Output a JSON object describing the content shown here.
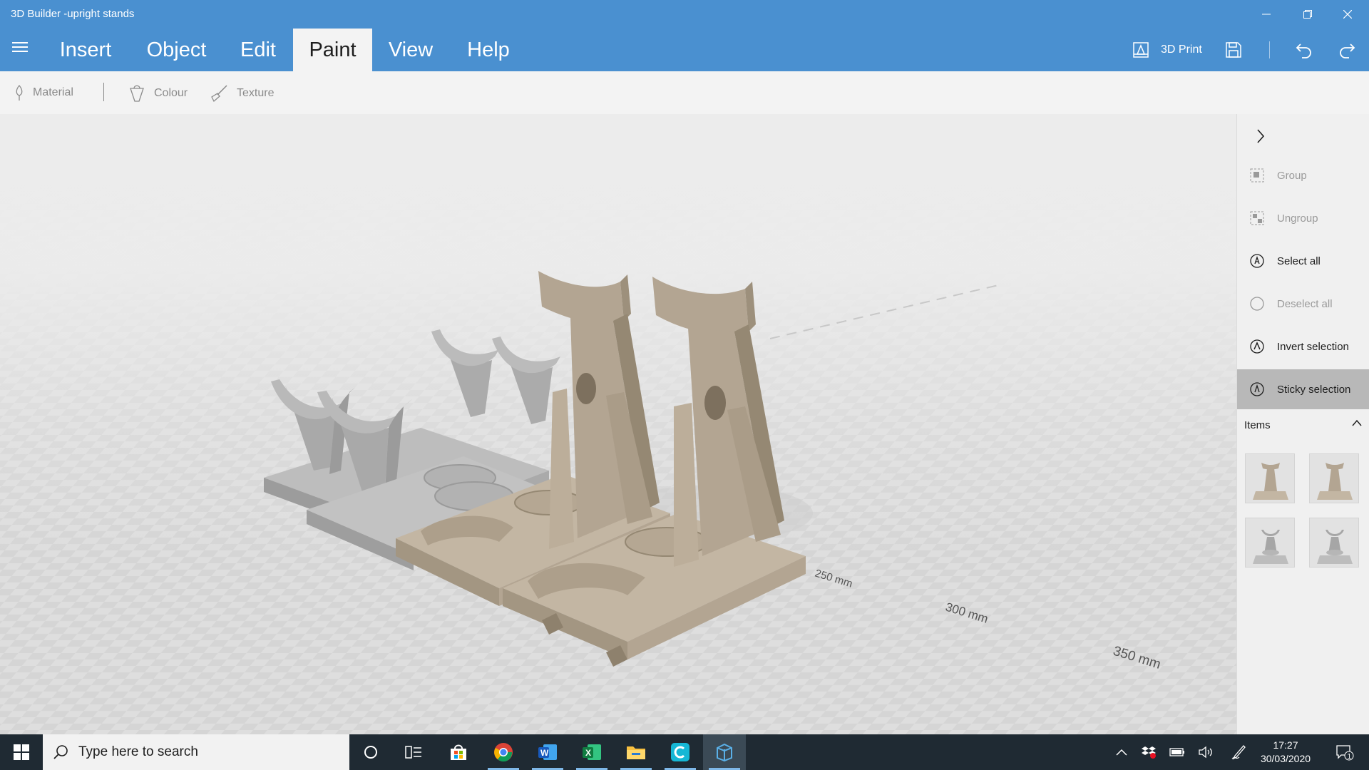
{
  "window": {
    "title": "3D Builder -upright stands",
    "controls": [
      "minimize-icon",
      "restore-icon",
      "close-icon"
    ]
  },
  "menu": {
    "tabs": [
      {
        "label": "Insert"
      },
      {
        "label": "Object"
      },
      {
        "label": "Edit"
      },
      {
        "label": "Paint",
        "active": true
      },
      {
        "label": "View"
      },
      {
        "label": "Help"
      }
    ],
    "print_label": "3D Print"
  },
  "ribbon": {
    "items": [
      {
        "label": "Material",
        "icon": "material-icon"
      },
      {
        "label": "Colour",
        "icon": "colour-bucket-icon"
      },
      {
        "label": "Texture",
        "icon": "texture-brush-icon"
      }
    ]
  },
  "viewport": {
    "scale_labels": [
      "250 mm",
      "300 mm",
      "350 mm"
    ]
  },
  "panel": {
    "actions": [
      {
        "label": "Group",
        "enabled": false,
        "icon": "group-icon"
      },
      {
        "label": "Ungroup",
        "enabled": false,
        "icon": "ungroup-icon"
      },
      {
        "label": "Select all",
        "enabled": true,
        "icon": "select-all-icon"
      },
      {
        "label": "Deselect all",
        "enabled": false,
        "icon": "deselect-all-icon"
      },
      {
        "label": "Invert selection",
        "enabled": true,
        "icon": "invert-selection-icon"
      },
      {
        "label": "Sticky selection",
        "enabled": true,
        "active": true,
        "icon": "sticky-selection-icon"
      }
    ],
    "items_title": "Items"
  },
  "taskbar": {
    "search_placeholder": "Type here to search",
    "time": "17:27",
    "date": "30/03/2020",
    "notification_count": "1"
  },
  "colors": {
    "accent": "#4a90d0",
    "model_tan": "#b3a592",
    "model_grey": "#a6a6a6",
    "taskbar": "#1f2a33"
  }
}
